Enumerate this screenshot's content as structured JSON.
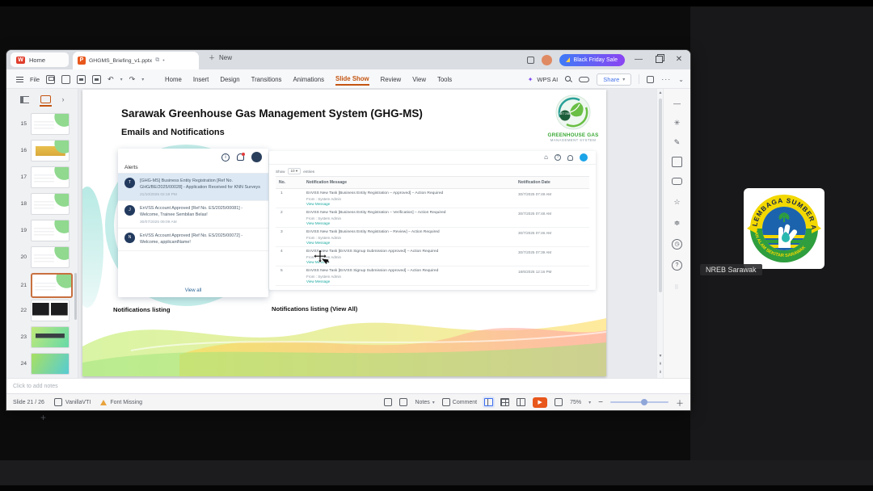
{
  "conference": {
    "participant_label": "NREB Sarawak",
    "logo_top_text": "LEMBAGA SUMBER ASLI",
    "logo_bottom_text": "DAN ALAM SEKITAR SARAWAK"
  },
  "titlebar": {
    "home_tab": "Home",
    "doc_tab": "GHGMS_Briefing_v1.pptx",
    "new_label": "New",
    "promo_label": "Black Friday Sale"
  },
  "menubar": {
    "file": "File",
    "items": [
      {
        "label": "Home",
        "state": ""
      },
      {
        "label": "Insert",
        "state": ""
      },
      {
        "label": "Design",
        "state": ""
      },
      {
        "label": "Transitions",
        "state": ""
      },
      {
        "label": "Animations",
        "state": ""
      },
      {
        "label": "Slide Show",
        "state": "active"
      },
      {
        "label": "Review",
        "state": ""
      },
      {
        "label": "View",
        "state": ""
      },
      {
        "label": "Tools",
        "state": ""
      }
    ],
    "wps_ai": "WPS AI",
    "share_label": "Share"
  },
  "icons": {
    "right_rail": [
      "collapse",
      "tools",
      "ai-writer",
      "shapes",
      "comment",
      "star",
      "settings",
      "history",
      "help",
      "apps"
    ],
    "alerts_header": [
      "info",
      "bell",
      "user-avatar"
    ],
    "notif_header": [
      "home",
      "help",
      "bell",
      "user-avatar"
    ]
  },
  "sidebar": {
    "slides": [
      {
        "num": "15",
        "variant": "v-lines",
        "state": ""
      },
      {
        "num": "16",
        "variant": "v-banner",
        "state": ""
      },
      {
        "num": "17",
        "variant": "v-lines",
        "state": ""
      },
      {
        "num": "18",
        "variant": "v-lines",
        "state": ""
      },
      {
        "num": "19",
        "variant": "v-lines",
        "state": ""
      },
      {
        "num": "20",
        "variant": "v-lines",
        "state": ""
      },
      {
        "num": "21",
        "variant": "v-lines",
        "state": "sel"
      },
      {
        "num": "22",
        "variant": "v-dark",
        "state": ""
      },
      {
        "num": "23",
        "variant": "v-greenbar",
        "state": ""
      },
      {
        "num": "24",
        "variant": "v-grad",
        "state": ""
      }
    ],
    "add_label": "+"
  },
  "slide": {
    "title": "Sarawak Greenhouse Gas Management System (GHG-MS)",
    "subtitle": "Emails and Notifications",
    "logo": {
      "badge": "NET 2050",
      "line1": "GREENHOUSE GAS",
      "line2": "MANAGEMENT SYSTEM"
    },
    "alerts": {
      "header": "Alerts",
      "items": [
        {
          "avatar": "T",
          "text": "[GHG-MS] Business Entity Registration [Ref No. GHG/BE/2025/00028] - Application Received for KNN Surveys",
          "time": "21/10/2025 02:19 PM",
          "state": "hl"
        },
        {
          "avatar": "J",
          "text": "EnVSS Account Approved [Ref No. ES/2025/00081] - Welcome, Trainee Sembilan Belas!",
          "time": "30/07/2025 09:09 AM",
          "state": ""
        },
        {
          "avatar": "N",
          "text": "EnVSS Account Approved [Ref No. ES/2025/00072] - Welcome, applicantName!",
          "time": "",
          "state": ""
        }
      ],
      "view_all": "View all"
    },
    "notifications": {
      "show": "Show",
      "page_size": "10",
      "entries": "entries",
      "headers": {
        "no": "No.",
        "message": "Notification Message",
        "date": "Notification Date"
      },
      "rows": [
        {
          "no": "1",
          "message": "EnVSS New Task [Business Entity Registration – Approved] – Action Required",
          "from": "From : System Admin",
          "link": "View Message",
          "date": "30/7/2025 07:49 AM"
        },
        {
          "no": "2",
          "message": "EnVSS New Task [Business Entity Registration – Verification] – Action Required",
          "from": "From : System Admin",
          "link": "View Message",
          "date": "30/7/2025 07:48 AM"
        },
        {
          "no": "3",
          "message": "EnVSS New Task [Business Entity Registration – Review] – Action Required",
          "from": "From : System Admin",
          "link": "View Message",
          "date": "30/7/2025 07:46 AM"
        },
        {
          "no": "4",
          "message": "EnVSS New Task [EnVSS Signup Submission Approved] – Action Required",
          "from": "From : System Admin",
          "link": "View Message",
          "date": "30/7/2025 07:39 AM"
        },
        {
          "no": "5",
          "message": "EnVSS New Task [EnVSS Signup Submission Approved] – Action Required",
          "from": "From : System Admin",
          "link": "View Message",
          "date": "18/6/2025 12:16 PM"
        }
      ]
    },
    "captions": {
      "left": "Notifications listing",
      "right": "Notifications listing (View All)"
    }
  },
  "notes": {
    "placeholder": "Click to add notes"
  },
  "statusbar": {
    "slide_indicator": "Slide 21 / 26",
    "theme": "VanillaVTI",
    "font_missing": "Font Missing",
    "notes_label": "Notes",
    "comment_label": "Comment",
    "zoom": "75%"
  },
  "colors": {
    "accent_orange": "#c45511",
    "wps_red": "#e03e2d",
    "app_teal": "#18a8a0",
    "promo_from": "#3e7bf7",
    "promo_to": "#8b44f2"
  }
}
